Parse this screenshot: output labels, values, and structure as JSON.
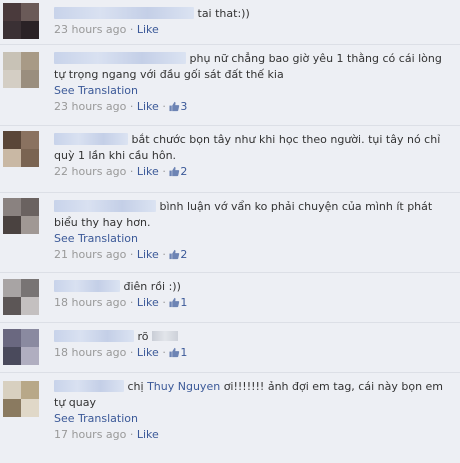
{
  "comments": [
    {
      "text": "tai that:))",
      "see_translation": "",
      "time": "23 hours ago",
      "like_label": "Like",
      "likes": ""
    },
    {
      "text": "phụ nữ chẳng bao giờ yêu 1 thằng có cái lòng tự trọng ngang với đầu gối sát đất thế kia",
      "see_translation": "See Translation",
      "time": "23 hours ago",
      "like_label": "Like",
      "likes": "3"
    },
    {
      "text": "bắt chước bọn tây như khi học theo người. tụi tây nó chỉ quỳ 1 lần khi cầu hôn.",
      "see_translation": "",
      "time": "22 hours ago",
      "like_label": "Like",
      "likes": "2"
    },
    {
      "text": "bình luận vớ vẩn ko phải chuyện của mình ít phát biểu thy hay hơn.",
      "see_translation": "See Translation",
      "time": "21 hours ago",
      "like_label": "Like",
      "likes": "2"
    },
    {
      "text": "điên rồi :))",
      "see_translation": "",
      "time": "18 hours ago",
      "like_label": "Like",
      "likes": "1"
    },
    {
      "text": "rõ",
      "see_translation": "",
      "time": "18 hours ago",
      "like_label": "Like",
      "likes": "1"
    },
    {
      "text_prefix": "chị",
      "mention": "Thuy Nguyen",
      "text": "ơi!!!!!!! ảnh đợi em tag, cái này bọn em tự quay",
      "see_translation": "See Translation",
      "time": "17 hours ago",
      "like_label": "Like",
      "likes": ""
    }
  ],
  "separator": "·",
  "icons": {
    "like": "thumbs-up-icon"
  },
  "colors": {
    "background": "#edeff4",
    "link": "#3b5998",
    "meta": "#999999",
    "text": "#333333"
  }
}
